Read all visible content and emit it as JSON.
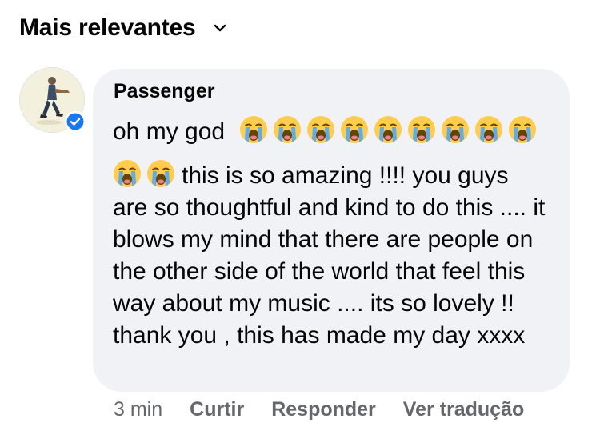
{
  "sort": {
    "label": "Mais relevantes",
    "icon": "chevron-down-icon"
  },
  "comment": {
    "author": "Passenger",
    "verified": true,
    "line1_text": "oh my god",
    "line2_text": "this is so amazing !!!! you guys",
    "body_text": "are so thoughtful and kind to do this .... it blows my mind that there are people on the other side of the world that feel this way about my music .... its so lovely !! thank you , this has made my day xxxx",
    "emoji": "loudly-crying-face-icon",
    "emoji_count_line1": 9,
    "emoji_count_line2": 2,
    "bubble_color": "#f0f2f5",
    "verified_color": "#1877f2"
  },
  "actions": {
    "time": "3 min",
    "like": "Curtir",
    "reply": "Responder",
    "translate": "Ver tradução"
  }
}
